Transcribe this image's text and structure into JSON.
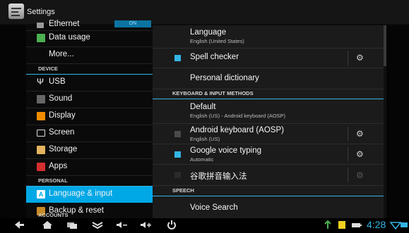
{
  "app": {
    "title": "Settings"
  },
  "left": {
    "ethernet": {
      "label": "Ethernet",
      "toggle": "ON"
    },
    "items": [
      {
        "label": "Data usage"
      },
      {
        "label": "More..."
      },
      {
        "label": "USB"
      },
      {
        "label": "Sound"
      },
      {
        "label": "Display"
      },
      {
        "label": "Screen"
      },
      {
        "label": "Storage"
      },
      {
        "label": "Apps"
      },
      {
        "label": "Language & input"
      },
      {
        "label": "Backup & reset"
      }
    ],
    "headers": {
      "device": "DEVICE",
      "personal": "PERSONAL",
      "accounts": "ACCOUNTS"
    }
  },
  "right": {
    "language": {
      "title": "Language",
      "subtitle": "English (United States)"
    },
    "spell": {
      "title": "Spell checker",
      "checked": true
    },
    "dictionary": {
      "title": "Personal dictionary"
    },
    "kim_header": "KEYBOARD & INPUT METHODS",
    "default": {
      "title": "Default",
      "subtitle": "English (US) - Android keyboard (AOSP)"
    },
    "aosp": {
      "title": "Android keyboard (AOSP)",
      "subtitle": "English (US)",
      "checked": true,
      "disabled": true
    },
    "voice": {
      "title": "Google voice typing",
      "subtitle": "Automatic",
      "checked": true
    },
    "pinyin": {
      "title": "谷歌拼音输入法",
      "checked": false
    },
    "speech_header": "SPEECH",
    "voicesearch": {
      "title": "Voice Search"
    }
  },
  "status": {
    "time": "4:28"
  },
  "icons": {
    "nav": [
      "back-icon",
      "home-icon",
      "recent-apps-icon",
      "menu-collapse-icon",
      "volume-down-icon",
      "volume-up-icon",
      "power-icon"
    ],
    "status": [
      "usb-debug-icon",
      "sd-card-icon",
      "battery-icon",
      "wifi-icon",
      "ethernet-icon"
    ]
  },
  "colors": {
    "accent": "#33b5e5",
    "selected": "#00a8e6"
  }
}
